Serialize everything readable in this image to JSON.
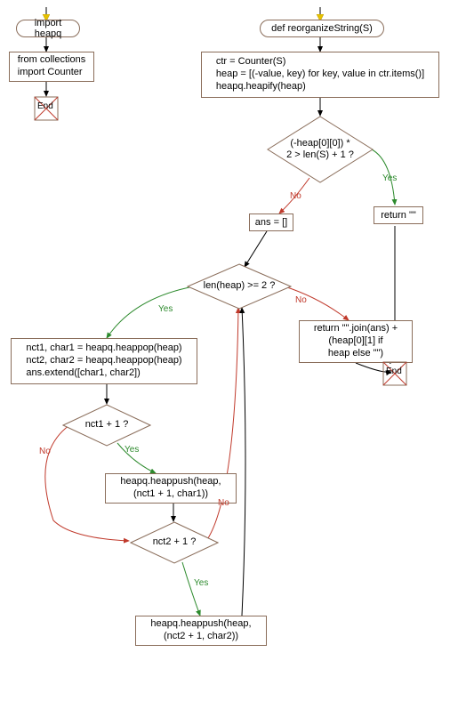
{
  "flow1": {
    "start": "import heapq",
    "import_box": "from collections\nimport Counter",
    "end_label": "End"
  },
  "flow2": {
    "func_def": "def reorganizeString(S)",
    "init_box": "ctr = Counter(S)\nheap = [(-value, key) for key, value in ctr.items()]\nheapq.heapify(heap)",
    "cond1": "(-heap[0][0]) *\n2 > len(S) + 1 ?",
    "ans_init": "ans = []",
    "return_empty": "return \"\"",
    "cond2": "len(heap) >= 2 ?",
    "pop_box": "nct1, char1 = heapq.heappop(heap)\nnct2, char2 = heapq.heappop(heap)\nans.extend([char1, char2])",
    "cond3": "nct1 + 1 ?",
    "push1": "heapq.heappush(heap,\n(nct1 + 1, char1))",
    "cond4": "nct2 + 1 ?",
    "push2": "heapq.heappush(heap,\n(nct2 + 1, char2))",
    "return_join": "return \"\".join(ans) +\n(heap[0][1] if\nheap else \"\")",
    "end_label": "End"
  },
  "labels": {
    "yes": "Yes",
    "no": "No"
  }
}
